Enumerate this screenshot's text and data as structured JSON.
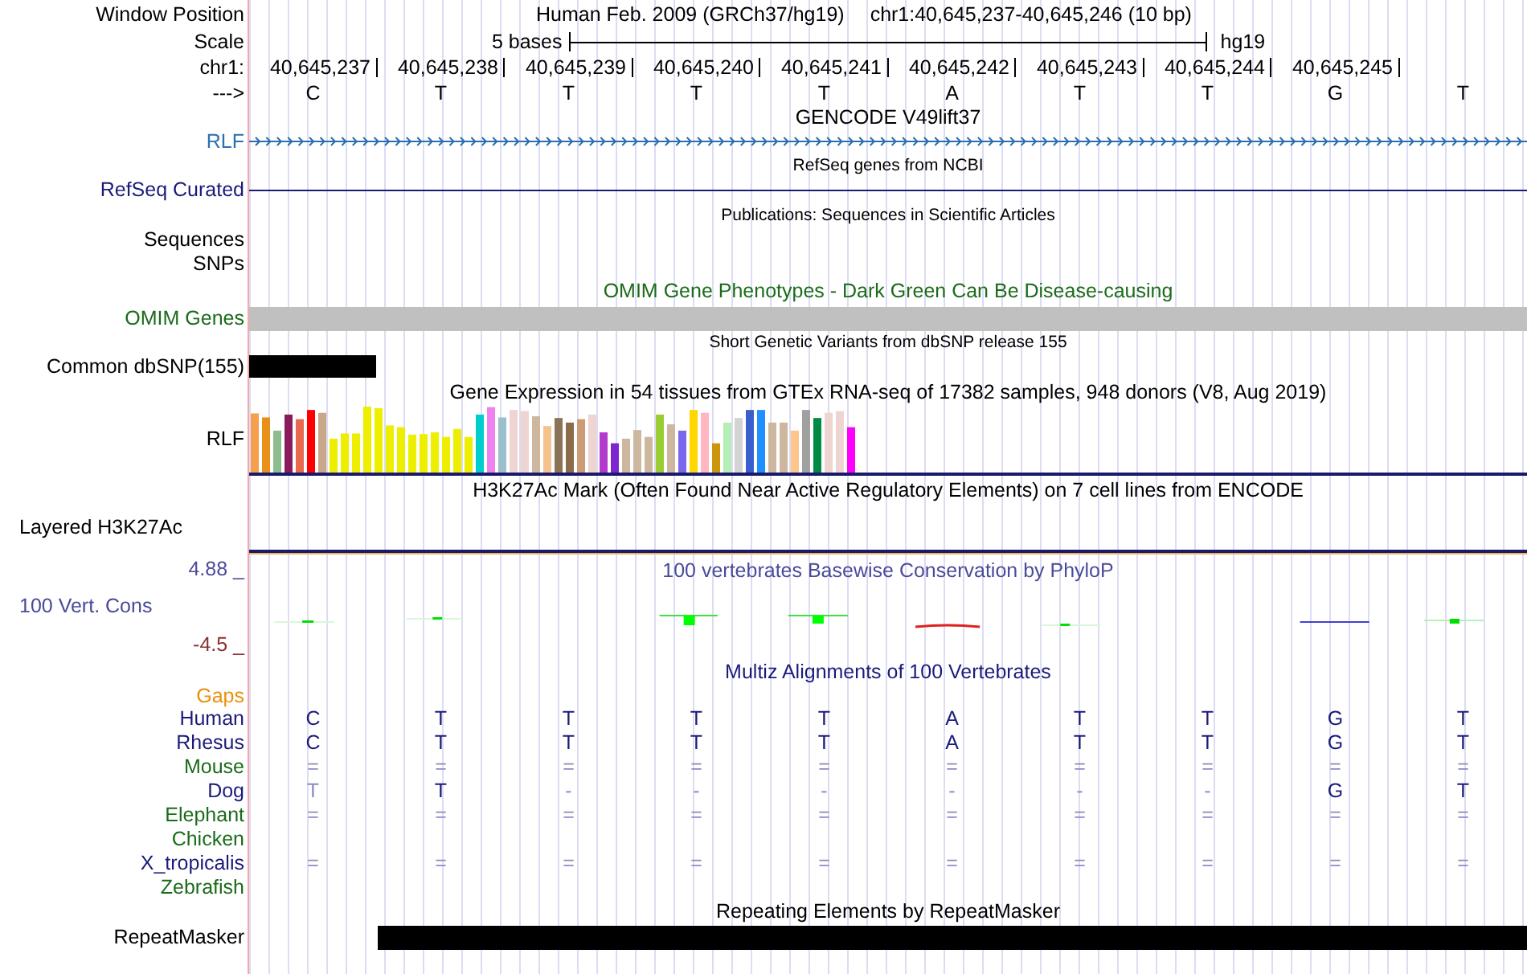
{
  "header": {
    "label": "Window Position",
    "assembly": "Human Feb. 2009 (GRCh37/hg19)",
    "position": "chr1:40,645,237-40,645,246 (10 bp)"
  },
  "scale": {
    "label": "Scale",
    "span": "5 bases",
    "assembly": "hg19"
  },
  "coordinates": {
    "label": "chr1:",
    "ticks": [
      "40,645,237",
      "40,645,238",
      "40,645,239",
      "40,645,240",
      "40,645,241",
      "40,645,242",
      "40,645,243",
      "40,645,244",
      "40,645,245"
    ]
  },
  "sequence": {
    "label": "--->",
    "bases": [
      "C",
      "T",
      "T",
      "T",
      "T",
      "A",
      "T",
      "T",
      "G",
      "T"
    ]
  },
  "gencode": {
    "title": "GENCODE V49lift37",
    "label": "RLF"
  },
  "refseq": {
    "title": "RefSeq genes from NCBI",
    "label": "RefSeq Curated"
  },
  "publications": {
    "title": "Publications: Sequences in Scientific Articles",
    "label": "Sequences"
  },
  "snps": {
    "label": "SNPs"
  },
  "omim": {
    "title": "OMIM Gene Phenotypes - Dark Green Can Be Disease-causing",
    "label": "OMIM Genes"
  },
  "dbsnp": {
    "title": "Short Genetic Variants from dbSNP release 155",
    "label": "Common dbSNP(155)"
  },
  "gtex": {
    "title": "Gene Expression in 54 tissues from GTEx RNA-seq of 17382 samples, 948 donors (V8, Aug 2019)",
    "label": "RLF"
  },
  "h3k27ac": {
    "title": "H3K27Ac Mark (Often Found Near Active Regulatory Elements) on 7 cell lines from ENCODE",
    "label": "Layered H3K27Ac"
  },
  "phylop": {
    "title": "100 vertebrates Basewise Conservation by PhyloP",
    "label": "100 Vert. Cons",
    "max": "4.88 _",
    "min": "-4.5 _"
  },
  "multiz": {
    "title": "Multiz Alignments of 100 Vertebrates",
    "gaps_label": "Gaps",
    "species": [
      {
        "name": "Human",
        "color": "#1a1a7a",
        "cells": [
          {
            "text": "C",
            "dim": false
          },
          {
            "text": "T",
            "dim": false
          },
          {
            "text": "T",
            "dim": false
          },
          {
            "text": "T",
            "dim": false
          },
          {
            "text": "T",
            "dim": false
          },
          {
            "text": "A",
            "dim": false
          },
          {
            "text": "T",
            "dim": false
          },
          {
            "text": "T",
            "dim": false
          },
          {
            "text": "G",
            "dim": false
          },
          {
            "text": "T",
            "dim": false
          }
        ]
      },
      {
        "name": "Rhesus",
        "color": "#1a1a7a",
        "cells": [
          {
            "text": "C",
            "dim": false
          },
          {
            "text": "T",
            "dim": false
          },
          {
            "text": "T",
            "dim": false
          },
          {
            "text": "T",
            "dim": false
          },
          {
            "text": "T",
            "dim": false
          },
          {
            "text": "A",
            "dim": false
          },
          {
            "text": "T",
            "dim": false
          },
          {
            "text": "T",
            "dim": false
          },
          {
            "text": "G",
            "dim": false
          },
          {
            "text": "T",
            "dim": false
          }
        ]
      },
      {
        "name": "Mouse",
        "color": "#1a6b1a",
        "cells": [
          {
            "text": "=",
            "dim": true
          },
          {
            "text": "=",
            "dim": true
          },
          {
            "text": "=",
            "dim": true
          },
          {
            "text": "=",
            "dim": true
          },
          {
            "text": "=",
            "dim": true
          },
          {
            "text": "=",
            "dim": true
          },
          {
            "text": "=",
            "dim": true
          },
          {
            "text": "=",
            "dim": true
          },
          {
            "text": "=",
            "dim": true
          },
          {
            "text": "=",
            "dim": true
          }
        ]
      },
      {
        "name": "Dog",
        "color": "#1a1a7a",
        "cells": [
          {
            "text": "T",
            "dim": true
          },
          {
            "text": "T",
            "dim": false
          },
          {
            "text": "-",
            "dim": true
          },
          {
            "text": "-",
            "dim": true
          },
          {
            "text": "-",
            "dim": true
          },
          {
            "text": "-",
            "dim": true
          },
          {
            "text": "-",
            "dim": true
          },
          {
            "text": "-",
            "dim": true
          },
          {
            "text": "G",
            "dim": false
          },
          {
            "text": "T",
            "dim": false
          }
        ]
      },
      {
        "name": "Elephant",
        "color": "#1a6b1a",
        "cells": [
          {
            "text": "=",
            "dim": true
          },
          {
            "text": "=",
            "dim": true
          },
          {
            "text": "=",
            "dim": true
          },
          {
            "text": "=",
            "dim": true
          },
          {
            "text": "=",
            "dim": true
          },
          {
            "text": "=",
            "dim": true
          },
          {
            "text": "=",
            "dim": true
          },
          {
            "text": "=",
            "dim": true
          },
          {
            "text": "=",
            "dim": true
          },
          {
            "text": "=",
            "dim": true
          }
        ]
      },
      {
        "name": "Chicken",
        "color": "#1a6b1a"
      },
      {
        "name": "X_tropicalis",
        "color": "#1a1a7a",
        "cells": [
          {
            "text": "=",
            "dim": true
          },
          {
            "text": "=",
            "dim": true
          },
          {
            "text": "=",
            "dim": true
          },
          {
            "text": "=",
            "dim": true
          },
          {
            "text": "=",
            "dim": true
          },
          {
            "text": "=",
            "dim": true
          },
          {
            "text": "=",
            "dim": true
          },
          {
            "text": "=",
            "dim": true
          },
          {
            "text": "=",
            "dim": true
          },
          {
            "text": "=",
            "dim": true
          }
        ]
      },
      {
        "name": "Zebrafish",
        "color": "#1a6b1a"
      }
    ]
  },
  "repeatmasker": {
    "title": "Repeating Elements by RepeatMasker",
    "label": "RepeatMasker"
  }
}
